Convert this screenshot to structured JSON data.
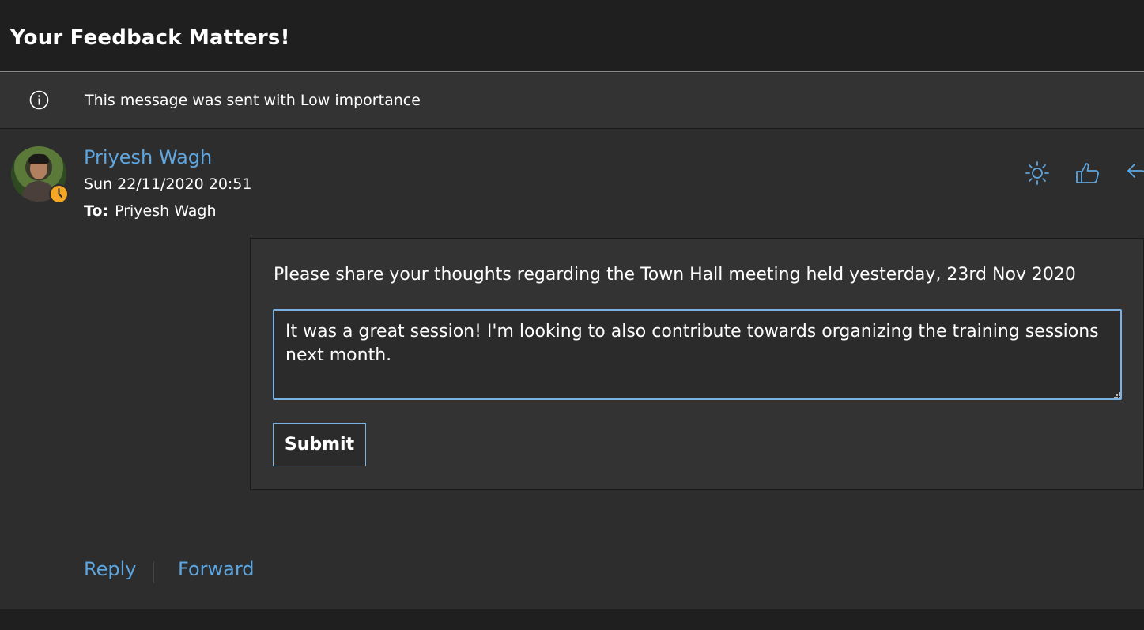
{
  "header": {
    "title": "Your Feedback Matters!"
  },
  "info_bar": {
    "icon": "info-icon",
    "text": "This message was sent with Low importance"
  },
  "message": {
    "sender_name": "Priyesh Wagh",
    "sent_date": "Sun 22/11/2020 20:51",
    "to_label": "To:",
    "to_value": "Priyesh Wagh",
    "avatar_icon": "avatar",
    "presence_icon": "clock-icon",
    "presence_color": "#f5a623"
  },
  "toolbar": {
    "icons": [
      "sun-icon",
      "thumbs-up-icon",
      "reply-icon"
    ]
  },
  "card": {
    "prompt": "Please share your thoughts regarding the Town Hall meeting held yesterday, 23rd Nov 2020",
    "feedback_value": "It was a great session! I'm looking to also contribute towards organizing the training sessions next month.",
    "submit_label": "Submit"
  },
  "footer": {
    "reply_label": "Reply",
    "forward_label": "Forward"
  },
  "colors": {
    "accent": "#5ea6e0",
    "input_border": "#7ab3e3",
    "background": "#2b2b2b"
  }
}
